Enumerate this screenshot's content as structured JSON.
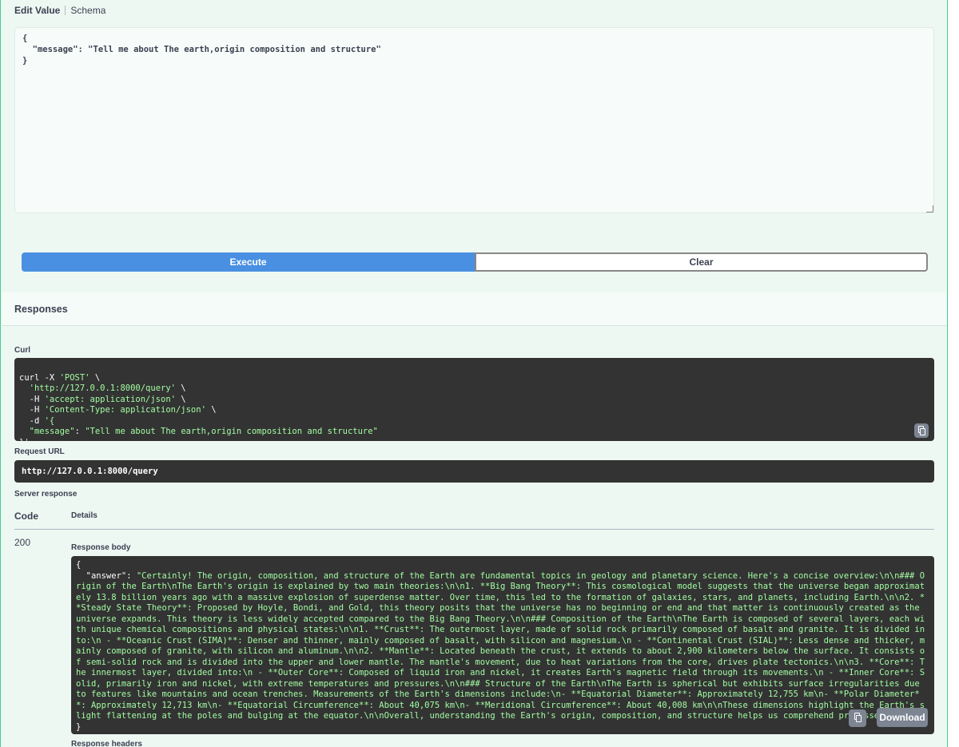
{
  "tabs": {
    "edit_value": "Edit Value",
    "schema": "Schema"
  },
  "request_body": {
    "value": "{\n  \"message\": \"Tell me about The earth,origin composition and structure\"\n}"
  },
  "buttons": {
    "execute": "Execute",
    "clear": "Clear",
    "download": "Download"
  },
  "responses": {
    "title": "Responses",
    "curl_label": "Curl",
    "curl_lines": [
      "curl -X 'POST' \\",
      "  'http://127.0.0.1:8000/query' \\",
      "  -H 'accept: application/json' \\",
      "  -H 'Content-Type: application/json' \\",
      "  -d '{",
      "  \"message\": \"Tell me about The earth,origin composition and structure\"",
      "}'"
    ],
    "request_url_label": "Request URL",
    "request_url": "http://127.0.0.1:8000/query",
    "server_response_label": "Server response",
    "code_header": "Code",
    "details_header": "Details",
    "status_code": "200",
    "response_body_label": "Response body",
    "body_open": "{",
    "answer_key": "  \"answer\": ",
    "answer_value": "\"Certainly! The origin, composition, and structure of the Earth are fundamental topics in geology and planetary science. Here's a concise overview:\\n\\n### Origin of the Earth\\nThe Earth's origin is explained by two main theories:\\n\\n1. **Big Bang Theory**: This cosmological model suggests that the universe began approximately 13.8 billion years ago with a massive explosion of superdense matter. Over time, this led to the formation of galaxies, stars, and planets, including Earth.\\n\\n2. **Steady State Theory**: Proposed by Hoyle, Bondi, and Gold, this theory posits that the universe has no beginning or end and that matter is continuously created as the universe expands. This theory is less widely accepted compared to the Big Bang Theory.\\n\\n### Composition of the Earth\\nThe Earth is composed of several layers, each with unique chemical compositions and physical states:\\n\\n1. **Crust**: The outermost layer, made of solid rock primarily composed of basalt and granite. It is divided into:\\n   - **Oceanic Crust (SIMA)**: Denser and thinner, mainly composed of basalt, with silicon and magnesium.\\n   - **Continental Crust (SIAL)**: Less dense and thicker, mainly composed of granite, with silicon and aluminum.\\n\\n2. **Mantle**: Located beneath the crust, it extends to about 2,900 kilometers below the surface. It consists of semi-solid rock and is divided into the upper and lower mantle. The mantle's movement, due to heat variations from the core, drives plate tectonics.\\n\\n3. **Core**: The innermost layer, divided into:\\n   - **Outer Core**: Composed of liquid iron and nickel, it creates Earth's magnetic field through its movements.\\n   - **Inner Core**: Solid, primarily iron and nickel, with extreme temperatures and pressures.\\n\\n### Structure of the Earth\\nThe Earth is spherical but exhibits surface irregularities due to features like mountains and ocean trenches. Measurements of the Earth's dimensions include:\\n- **Equatorial Diameter**: Approximately 12,755 km\\n- **Polar Diameter**: Approximately 12,713 km\\n- **Equatorial Circumference**: About 40,075 km\\n- **Meridional Circumference**: About 40,008 km\\n\\nThese dimensions highlight the Earth's slight flattening at the poles and bulging at the equator.\\n\\nOverall, understanding the Earth's origin, composition, and structure helps us comprehend processes like\"",
    "body_close": "}",
    "response_headers_label": "Response headers"
  },
  "icons": {
    "copy": "clipboard-copy-icon"
  }
}
